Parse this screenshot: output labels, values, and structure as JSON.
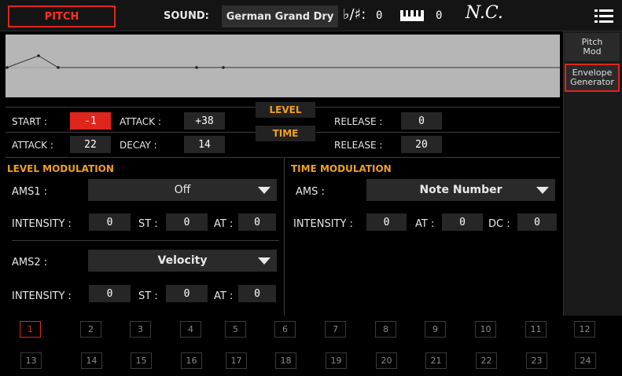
{
  "topbar": {
    "mode_label": "PITCH",
    "sound_label": "SOUND:",
    "sound_value": "German Grand Dry",
    "flat_sharp_symbol": "♭/♯:",
    "transpose_value": "0",
    "octave_value": "0",
    "chord": "N.C."
  },
  "side_tabs": [
    {
      "label_line1": "Pitch",
      "label_line2": "Mod"
    },
    {
      "label_line1": "Envelope",
      "label_line2": "Generator"
    }
  ],
  "envelope": {
    "level_tag": "LEVEL",
    "time_tag": "TIME",
    "level_row": {
      "start_label": "START :",
      "start_value": "-1",
      "attack_label": "ATTACK :",
      "attack_value": "+38",
      "release_label": "RELEASE :",
      "release_value": "0"
    },
    "time_row": {
      "attack_label": "ATTACK :",
      "attack_value": "22",
      "decay_label": "DECAY :",
      "decay_value": "14",
      "release_label": "RELEASE :",
      "release_value": "20"
    }
  },
  "level_modulation": {
    "title": "LEVEL MODULATION",
    "ams1_label": "AMS1 :",
    "ams1_value": "Off",
    "ams1_intensity_label": "INTENSITY :",
    "ams1_intensity": "0",
    "ams1_st_label": "ST :",
    "ams1_st": "0",
    "ams1_at_label": "AT :",
    "ams1_at": "0",
    "ams2_label": "AMS2 :",
    "ams2_value": "Velocity",
    "ams2_intensity_label": "INTENSITY :",
    "ams2_intensity": "0",
    "ams2_st_label": "ST :",
    "ams2_st": "0",
    "ams2_at_label": "AT :",
    "ams2_at": "0"
  },
  "time_modulation": {
    "title": "TIME MODULATION",
    "ams_label": "AMS :",
    "ams_value": "Note Number",
    "intensity_label": "INTENSITY :",
    "intensity": "0",
    "at_label": "AT :",
    "at": "0",
    "dc_label": "DC :",
    "dc": "0"
  },
  "pads": [
    "1",
    "2",
    "3",
    "4",
    "5",
    "6",
    "7",
    "8",
    "9",
    "10",
    "11",
    "12",
    "13",
    "14",
    "15",
    "16",
    "17",
    "18",
    "19",
    "20",
    "21",
    "22",
    "23",
    "24"
  ],
  "colors": {
    "accent": "#e0261c",
    "section_title": "#f0a020"
  }
}
